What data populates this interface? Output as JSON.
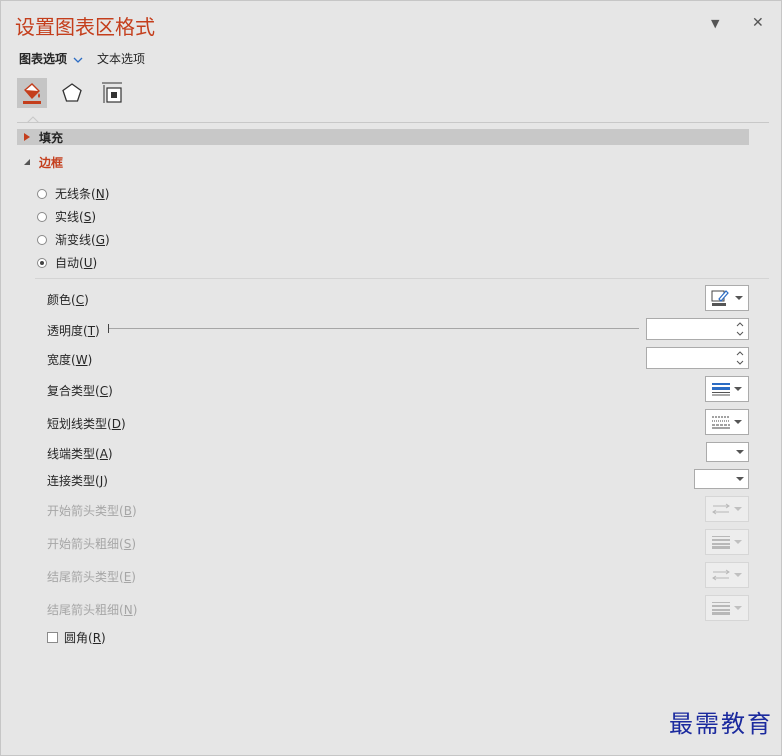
{
  "panel": {
    "title": "设置图表区格式",
    "collapse_symbol": "▼",
    "close_symbol": "✕"
  },
  "tabs": {
    "chart_options": "图表选项",
    "text_options": "文本选项"
  },
  "icon_tabs": [
    "fill-line-icon",
    "effects-pentagon-icon",
    "size-properties-icon"
  ],
  "sections": {
    "fill": {
      "label": "填充",
      "expanded": false
    },
    "border": {
      "label": "边框",
      "expanded": true
    }
  },
  "border_options": [
    {
      "label": "无线条",
      "key": "N",
      "selected": false
    },
    {
      "label": "实线",
      "key": "S",
      "selected": false
    },
    {
      "label": "渐变线",
      "key": "G",
      "selected": false
    },
    {
      "label": "自动",
      "key": "U",
      "selected": true
    }
  ],
  "properties": {
    "color": {
      "label": "颜色",
      "key": "C"
    },
    "transparency": {
      "label": "透明度",
      "key": "T",
      "value": ""
    },
    "width": {
      "label": "宽度",
      "key": "W",
      "value": ""
    },
    "compound_type": {
      "label": "复合类型",
      "key": "C"
    },
    "dash_type": {
      "label": "短划线类型",
      "key": "D"
    },
    "cap_type": {
      "label": "线端类型",
      "key": "A"
    },
    "join_type": {
      "label": "连接类型",
      "key": "J"
    },
    "begin_arrow_type": {
      "label": "开始箭头类型",
      "key": "B",
      "disabled": true
    },
    "begin_arrow_size": {
      "label": "开始箭头粗细",
      "key": "S",
      "disabled": true
    },
    "end_arrow_type": {
      "label": "结尾箭头类型",
      "key": "E",
      "disabled": true
    },
    "end_arrow_size": {
      "label": "结尾箭头粗细",
      "key": "N",
      "disabled": true
    },
    "rounded_corners": {
      "label": "圆角",
      "key": "R",
      "checked": false
    }
  },
  "watermark": "最需教育",
  "colors": {
    "accent": "#c43e1c",
    "icon_blue": "#2b6cc4",
    "watermark": "#1b2a9e"
  }
}
